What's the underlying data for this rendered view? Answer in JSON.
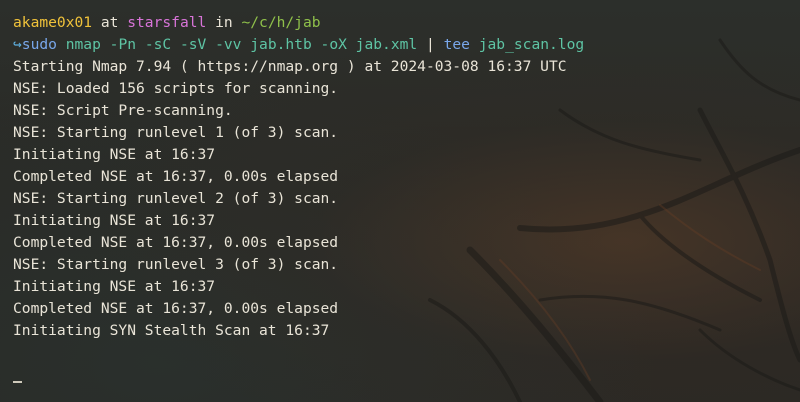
{
  "prompt": {
    "user": "akame0x01",
    "at": " at ",
    "host": "starsfall",
    "in": " in ",
    "path": "~/c/h/jab"
  },
  "command": {
    "arrow": "↪",
    "sudo": "sudo",
    "args": " nmap -Pn -sC -sV -vv jab.htb -oX jab.xml ",
    "pipe": "|",
    "tee": " tee",
    "tee_args": " jab_scan.log"
  },
  "output": [
    "Starting Nmap 7.94 ( https://nmap.org ) at 2024-03-08 16:37 UTC",
    "NSE: Loaded 156 scripts for scanning.",
    "NSE: Script Pre-scanning.",
    "NSE: Starting runlevel 1 (of 3) scan.",
    "Initiating NSE at 16:37",
    "Completed NSE at 16:37, 0.00s elapsed",
    "NSE: Starting runlevel 2 (of 3) scan.",
    "Initiating NSE at 16:37",
    "Completed NSE at 16:37, 0.00s elapsed",
    "NSE: Starting runlevel 3 (of 3) scan.",
    "Initiating NSE at 16:37",
    "Completed NSE at 16:37, 0.00s elapsed",
    "Initiating SYN Stealth Scan at 16:37"
  ],
  "colors": {
    "background": "#2a2b27",
    "text": "#e9e4d7",
    "user": "#f0c23a",
    "host": "#d874d8",
    "path": "#8fc04a",
    "command": "#5ec4a4",
    "sudo": "#79a7ea"
  }
}
